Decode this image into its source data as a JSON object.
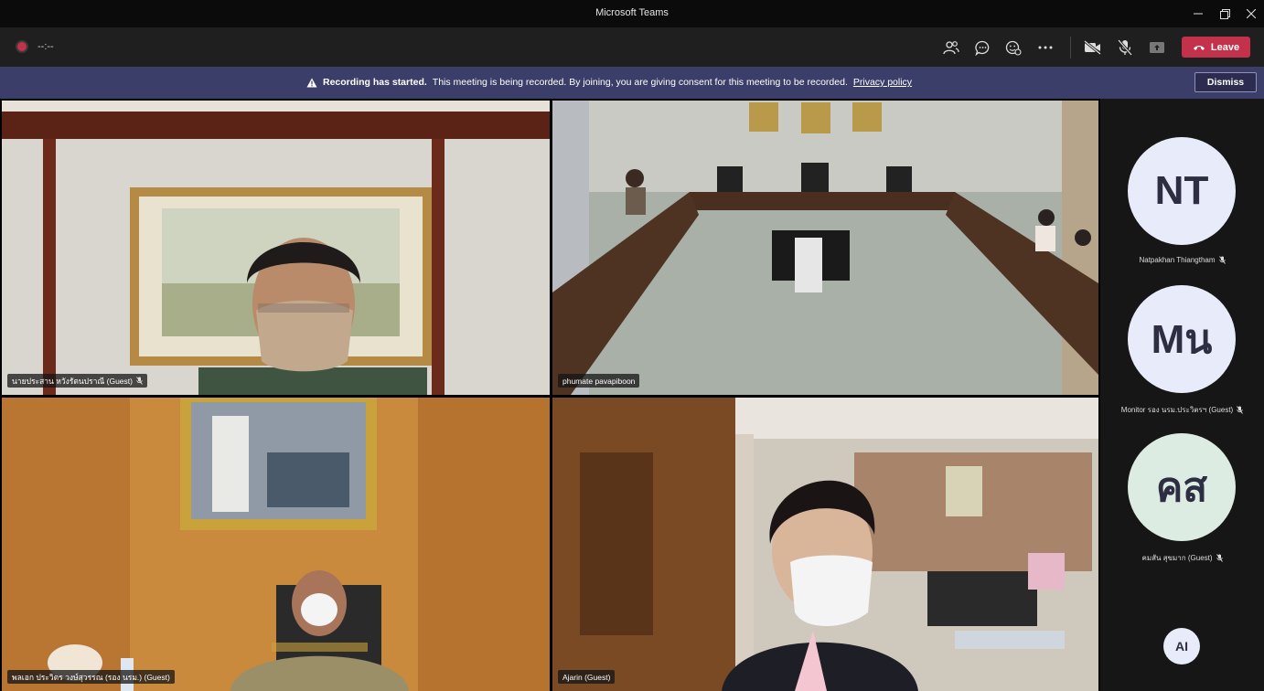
{
  "window": {
    "title": "Microsoft Teams"
  },
  "toolbar": {
    "timer": "--:--",
    "leave_label": "Leave",
    "icons": [
      "people-icon",
      "chat-icon",
      "reactions-icon",
      "more-icon",
      "camera-off-icon",
      "mic-off-icon",
      "share-icon"
    ]
  },
  "banner": {
    "heading": "Recording has started.",
    "message": "This meeting is being recorded. By joining, you are giving consent for this meeting to be recorded.",
    "link": "Privacy policy",
    "dismiss": "Dismiss"
  },
  "tiles": [
    {
      "name": "นายประสาน หวังรัตนปราณี (Guest)",
      "muted": true
    },
    {
      "name": "phumate pavapiboon",
      "muted": false
    },
    {
      "name": "พลเอก ประวิตร วงษ์สุวรรณ (รอง นรม.) (Guest)",
      "muted": true
    },
    {
      "name": "Ajarin (Guest)",
      "muted": false
    }
  ],
  "sidebar": {
    "participants": [
      {
        "initials": "NT",
        "name": "Natpakhan Thiangtham",
        "color": "#e8ebfa"
      },
      {
        "initials": "Mน",
        "name": "Monitor รอง นรม.ประวิตรฯ (Guest)",
        "color": "#e8ebfa"
      },
      {
        "initials": "คส",
        "name": "คมสัน สุขมาก (Guest)",
        "color": "#dcece3"
      }
    ],
    "extra": {
      "initials": "AI"
    }
  },
  "colors": {
    "leave": "#c4314b",
    "banner": "#3c3e6a",
    "toolbar": "#1f1f1f"
  }
}
